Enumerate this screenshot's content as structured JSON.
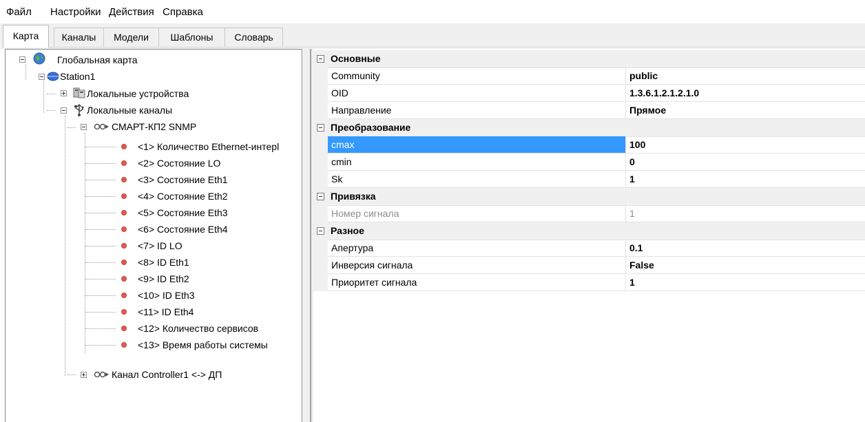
{
  "menu": {
    "items": [
      "Файл",
      "Настройки",
      "Действия",
      "Справка"
    ]
  },
  "tabs": {
    "items": [
      "Карта",
      "Каналы",
      "Модели",
      "Шаблоны",
      "Словарь"
    ],
    "active": "Карта"
  },
  "tree": {
    "root": {
      "label": "Глобальная карта",
      "icon": "globe-icon",
      "expanded": true
    },
    "station": {
      "label": "Station1",
      "icon": "station-icon",
      "expanded": true
    },
    "local_devices": {
      "label": "Локальные устройства",
      "icon": "devices-icon",
      "expanded": false
    },
    "local_channels": {
      "label": "Локальные каналы",
      "icon": "usb-icon",
      "expanded": true
    },
    "channel_smart": {
      "label": "СМАРТ-КП2 SNMP",
      "icon": "channel-icon",
      "expanded": true
    },
    "signals": [
      "<1> Количество Ethernet-интеpl",
      "<2> Состояние LO",
      "<3> Состояние Eth1",
      "<4> Состояние Eth2",
      "<5> Состояние Eth3",
      "<6> Состояние Eth4",
      "<7> ID LO",
      "<8> ID Eth1",
      "<9> ID Eth2",
      "<10> ID Eth3",
      "<11> ID Eth4",
      "<12> Количество сервисов",
      "<13> Время работы системы"
    ],
    "channel_controller": {
      "label": "Канал Controller1 <-> ДП",
      "icon": "channel-icon",
      "expanded": false
    }
  },
  "properties": {
    "categories": [
      {
        "name": "Основные",
        "props": [
          {
            "name": "Community",
            "value": "public"
          },
          {
            "name": "OID",
            "value": "1.3.6.1.2.1.2.1.0"
          },
          {
            "name": "Направление",
            "value": "Прямое"
          }
        ]
      },
      {
        "name": "Преобразование",
        "props": [
          {
            "name": "cmax",
            "value": "100",
            "selected": true
          },
          {
            "name": "cmin",
            "value": "0"
          },
          {
            "name": "Sk",
            "value": "1"
          }
        ]
      },
      {
        "name": "Привязка",
        "props": [
          {
            "name": "Номер сигнала",
            "value": "1",
            "disabled": true
          }
        ]
      },
      {
        "name": "Разное",
        "props": [
          {
            "name": "Апертура",
            "value": "0.1"
          },
          {
            "name": "Инверсия сигнала",
            "value": "False"
          },
          {
            "name": "Приоритет сигнала",
            "value": "1"
          }
        ]
      }
    ]
  },
  "colors": {
    "selection": "#3399ff",
    "signal_bullet": "#e05a55",
    "category_bg": "#f0f0f0"
  }
}
